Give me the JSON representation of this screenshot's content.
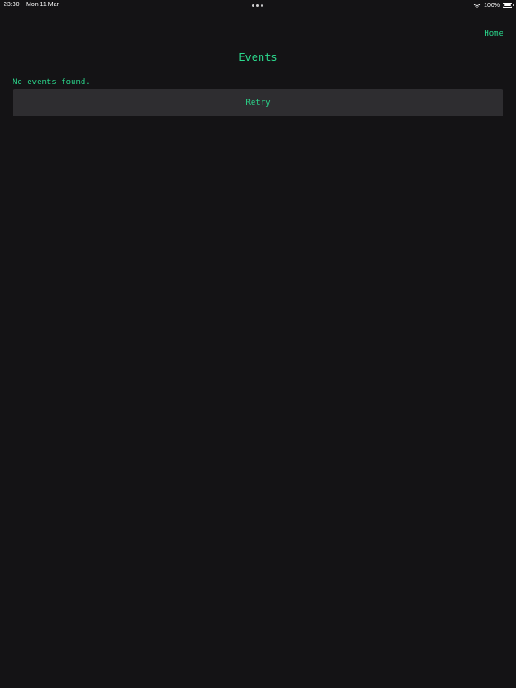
{
  "status_bar": {
    "time": "23:30",
    "date": "Mon 11 Mar",
    "battery_percent": "100%",
    "battery_level": 1.0,
    "icons": [
      "wifi-icon",
      "battery-icon"
    ]
  },
  "nav": {
    "home_label": "Home"
  },
  "page": {
    "title": "Events",
    "empty_message": "No events found.",
    "retry_label": "Retry"
  },
  "colors": {
    "background": "#141315",
    "accent": "#2bd98d",
    "button_background": "#2e2d30",
    "status_text": "#ffffff"
  }
}
